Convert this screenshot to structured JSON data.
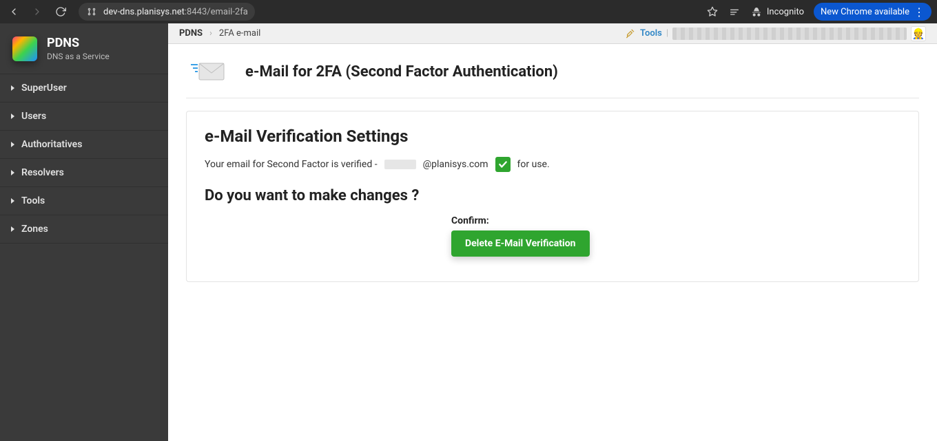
{
  "browser": {
    "url_host": "dev-dns.planisys.net",
    "url_port": ":8443",
    "url_path": "/email-2fa",
    "incognito_label": "Incognito",
    "pill_label": "New Chrome available"
  },
  "sidebar": {
    "brand_title": "PDNS",
    "brand_subtitle": "DNS as a Service",
    "items": [
      {
        "label": "SuperUser"
      },
      {
        "label": "Users"
      },
      {
        "label": "Authoritatives"
      },
      {
        "label": "Resolvers"
      },
      {
        "label": "Tools"
      },
      {
        "label": "Zones"
      }
    ]
  },
  "topbar": {
    "crumb_root": "PDNS",
    "crumb_current": "2FA e-mail",
    "tools_label": "Tools"
  },
  "page": {
    "heading": "e-Mail for 2FA (Second Factor Authentication)",
    "section_title": "e-Mail Verification Settings",
    "status_prefix": "Your email for Second Factor is verified -",
    "email_domain": "@planisys.com",
    "status_suffix": "for use.",
    "changes_title": "Do you want to make changes ?",
    "confirm_label": "Confirm:",
    "delete_button": "Delete E-Mail Verification"
  }
}
